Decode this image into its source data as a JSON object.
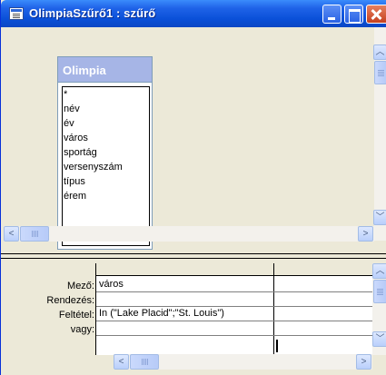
{
  "window": {
    "title": "OlimpiaSzűrő1 : szűrő"
  },
  "field_list": {
    "table_name": "Olimpia",
    "fields": [
      "*",
      "név",
      "év",
      "város",
      "sportág",
      "versenyszám",
      "típus",
      "érem"
    ]
  },
  "grid": {
    "row_labels": {
      "field": "Mező:",
      "sort": "Rendezés:",
      "criteria": "Feltétel:",
      "or": "vagy:"
    },
    "column1": {
      "field": "város",
      "sort": "",
      "criteria": "In (\"Lake Placid\";\"St. Louis\")",
      "or": ""
    }
  },
  "colors": {
    "titlebar": "#0a50d8",
    "field_list_header": "#a6b5e6",
    "window_bg": "#ece9d8"
  }
}
